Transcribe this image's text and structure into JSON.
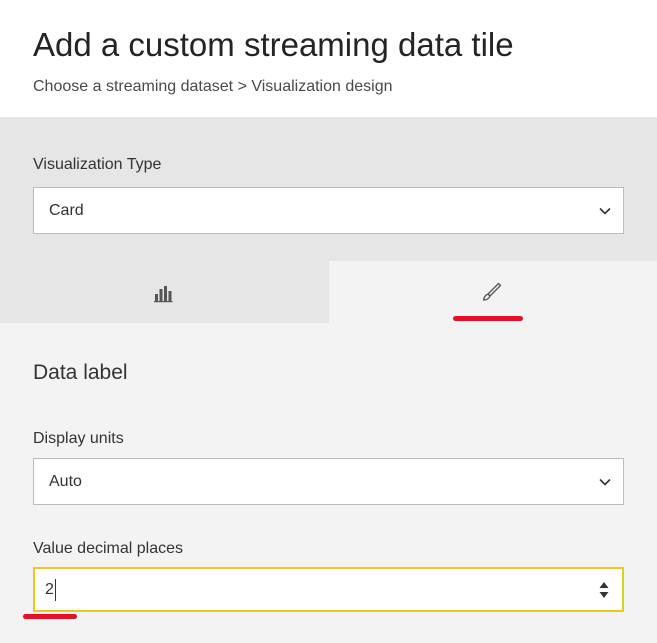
{
  "header": {
    "title": "Add a custom streaming data tile",
    "breadcrumb": "Choose a streaming dataset > Visualization design"
  },
  "visualization": {
    "label": "Visualization Type",
    "selected": "Card"
  },
  "tabs": [
    {
      "name": "Fields",
      "icon": "bar-chart-icon",
      "active": false
    },
    {
      "name": "Format",
      "icon": "paintbrush-icon",
      "active": true
    }
  ],
  "format": {
    "section_heading": "Data label",
    "display_units": {
      "label": "Display units",
      "selected": "Auto"
    },
    "decimal_places": {
      "label": "Value decimal places",
      "value": "2"
    }
  },
  "colors": {
    "highlight_underline": "#e81123",
    "focus_border": "#e8c92a",
    "panel_gray": "#e6e6e6",
    "panel_light": "#f3f3f3"
  }
}
